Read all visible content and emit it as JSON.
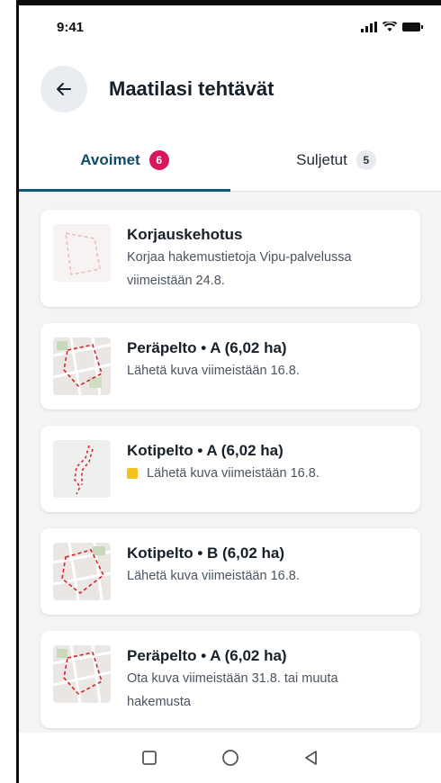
{
  "status_bar": {
    "time": "9:41"
  },
  "header": {
    "title": "Maatilasi tehtävät"
  },
  "tabs": [
    {
      "label": "Avoimet",
      "count": "6"
    },
    {
      "label": "Suljetut",
      "count": "5"
    }
  ],
  "tasks": [
    {
      "title": "Korjauskehotus",
      "desc_line1": "Korjaa hakemustietoja Vipu-palvelussa",
      "desc_line2": "viimeistään 24.8."
    },
    {
      "title": "Peräpelto • A (6,02 ha)",
      "desc_line1": "Lähetä kuva viimeistään 16.8."
    },
    {
      "title": "Kotipelto • A (6,02 ha)",
      "desc_line1": "Lähetä kuva viimeistään 16.8."
    },
    {
      "title": "Kotipelto • B (6,02 ha)",
      "desc_line1": "Lähetä kuva viimeistään 16.8."
    },
    {
      "title": "Peräpelto • A (6,02 ha)",
      "desc_line1": "Ota kuva viimeistään 31.8. tai muuta",
      "desc_line2": "hakemusta"
    }
  ],
  "colors": {
    "accent": "#0e5b78",
    "badge": "#d8145c",
    "warning": "#f5c21b"
  }
}
